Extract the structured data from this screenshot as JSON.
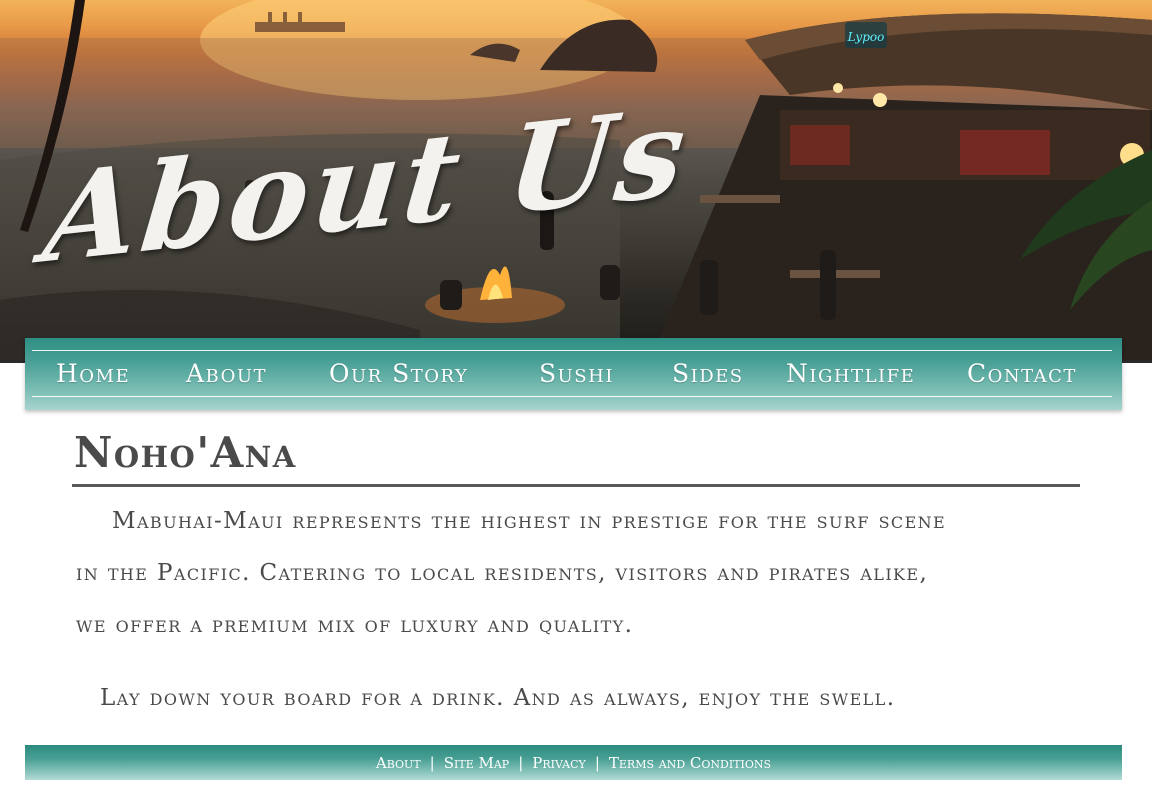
{
  "hero": {
    "title": "About Us",
    "bar_sign": "Lypoo"
  },
  "nav": {
    "items": [
      {
        "label": "Home"
      },
      {
        "label": "About"
      },
      {
        "label": "Our Story"
      },
      {
        "label": "Sushi"
      },
      {
        "label": "Sides"
      },
      {
        "label": "Nightlife"
      },
      {
        "label": "Contact"
      }
    ]
  },
  "content": {
    "heading": "Noho'Ana",
    "paragraph_lines": [
      "Mabuhai-Maui represents the highest in prestige for the surf scene",
      "in the Pacific. Catering to local residents, visitors and pirates alike,",
      "we offer a premium mix of luxury and quality."
    ],
    "tagline": "Lay down your board for a drink. And as always, enjoy the swell."
  },
  "footer": {
    "links": [
      {
        "label": "About"
      },
      {
        "label": "Site Map"
      },
      {
        "label": "Privacy"
      },
      {
        "label": "Terms and Conditions"
      }
    ],
    "separator": "|"
  },
  "colors": {
    "nav_teal": "#4ba197",
    "footer_teal": "#2a8a7f",
    "text": "#4a4a4a",
    "hero_sky": "#e89a48"
  }
}
